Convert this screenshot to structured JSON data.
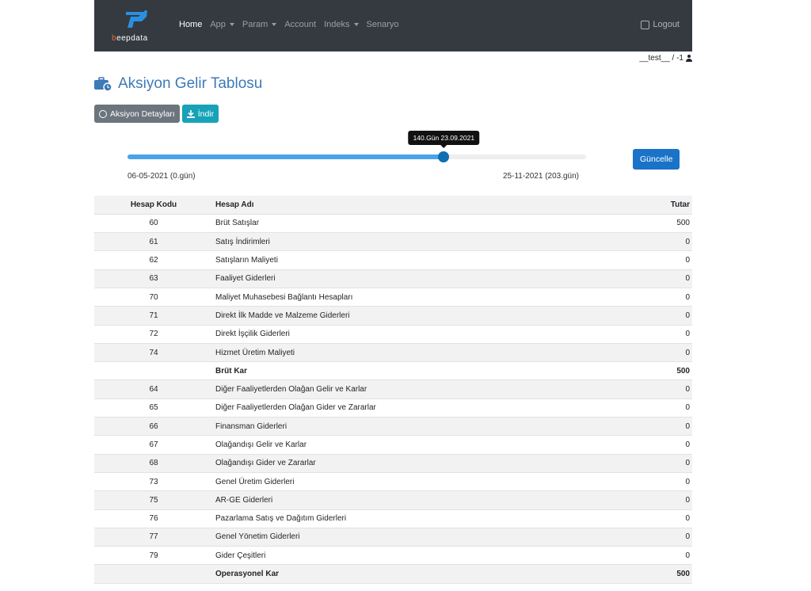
{
  "brand": {
    "text_b": "b",
    "text_rest": "eepdata"
  },
  "nav": {
    "items": [
      {
        "label": "Home",
        "active": true,
        "dropdown": false
      },
      {
        "label": "App",
        "active": false,
        "dropdown": true
      },
      {
        "label": "Param",
        "active": false,
        "dropdown": true
      },
      {
        "label": "Account",
        "active": false,
        "dropdown": false
      },
      {
        "label": "Indeks",
        "active": false,
        "dropdown": true
      },
      {
        "label": "Senaryo",
        "active": false,
        "dropdown": false
      }
    ],
    "logout": "Logout"
  },
  "user": {
    "label": "__test__ / -1"
  },
  "page": {
    "title": "Aksiyon Gelir Tablosu"
  },
  "buttons": {
    "details": "Aksiyon Detayları",
    "download": "İndir",
    "update": "Güncelle"
  },
  "slider": {
    "value_fraction": 0.6897,
    "tooltip": "140.Gün 23.09.2021",
    "min_label": "06-05-2021 (0.gün)",
    "max_label": "25-11-2021 (203.gün)"
  },
  "table": {
    "headers": {
      "code": "Hesap Kodu",
      "name": "Hesap Adı",
      "amount": "Tutar"
    },
    "rows": [
      {
        "code": "60",
        "name": "Brüt Satışlar",
        "amount": "500",
        "bold": false
      },
      {
        "code": "61",
        "name": "Satış İndirimleri",
        "amount": "0",
        "bold": false
      },
      {
        "code": "62",
        "name": "Satışların Maliyeti",
        "amount": "0",
        "bold": false
      },
      {
        "code": "63",
        "name": "Faaliyet Giderleri",
        "amount": "0",
        "bold": false
      },
      {
        "code": "70",
        "name": "Maliyet Muhasebesi Bağlantı Hesapları",
        "amount": "0",
        "bold": false
      },
      {
        "code": "71",
        "name": "Direkt İlk Madde ve Malzeme Giderleri",
        "amount": "0",
        "bold": false
      },
      {
        "code": "72",
        "name": "Direkt İşçilik Giderleri",
        "amount": "0",
        "bold": false
      },
      {
        "code": "74",
        "name": "Hizmet Üretim Maliyeti",
        "amount": "0",
        "bold": false
      },
      {
        "code": "",
        "name": "Brüt Kar",
        "amount": "500",
        "bold": true
      },
      {
        "code": "64",
        "name": "Diğer Faaliyetlerden Olağan Gelir ve Karlar",
        "amount": "0",
        "bold": false
      },
      {
        "code": "65",
        "name": "Diğer Faaliyetlerden Olağan Gider ve Zararlar",
        "amount": "0",
        "bold": false
      },
      {
        "code": "66",
        "name": "Finansman Giderleri",
        "amount": "0",
        "bold": false
      },
      {
        "code": "67",
        "name": "Olağandışı Gelir ve Karlar",
        "amount": "0",
        "bold": false
      },
      {
        "code": "68",
        "name": "Olağandışı Gider ve Zararlar",
        "amount": "0",
        "bold": false
      },
      {
        "code": "73",
        "name": "Genel Üretim Giderleri",
        "amount": "0",
        "bold": false
      },
      {
        "code": "75",
        "name": "AR-GE Giderleri",
        "amount": "0",
        "bold": false
      },
      {
        "code": "76",
        "name": "Pazarlama Satış ve Dağıtım Giderleri",
        "amount": "0",
        "bold": false
      },
      {
        "code": "77",
        "name": "Genel Yönetim Giderleri",
        "amount": "0",
        "bold": false
      },
      {
        "code": "79",
        "name": "Gider Çeşitleri",
        "amount": "0",
        "bold": false
      },
      {
        "code": "",
        "name": "Operasyonel Kar",
        "amount": "500",
        "bold": true
      }
    ]
  },
  "colors": {
    "navbar": "#343a40",
    "title": "#3d7ab8",
    "slider_fill": "#4aa3e8",
    "slider_thumb": "#0d6eb3",
    "update_btn": "#1a73c9",
    "download_btn": "#17a2b8"
  }
}
